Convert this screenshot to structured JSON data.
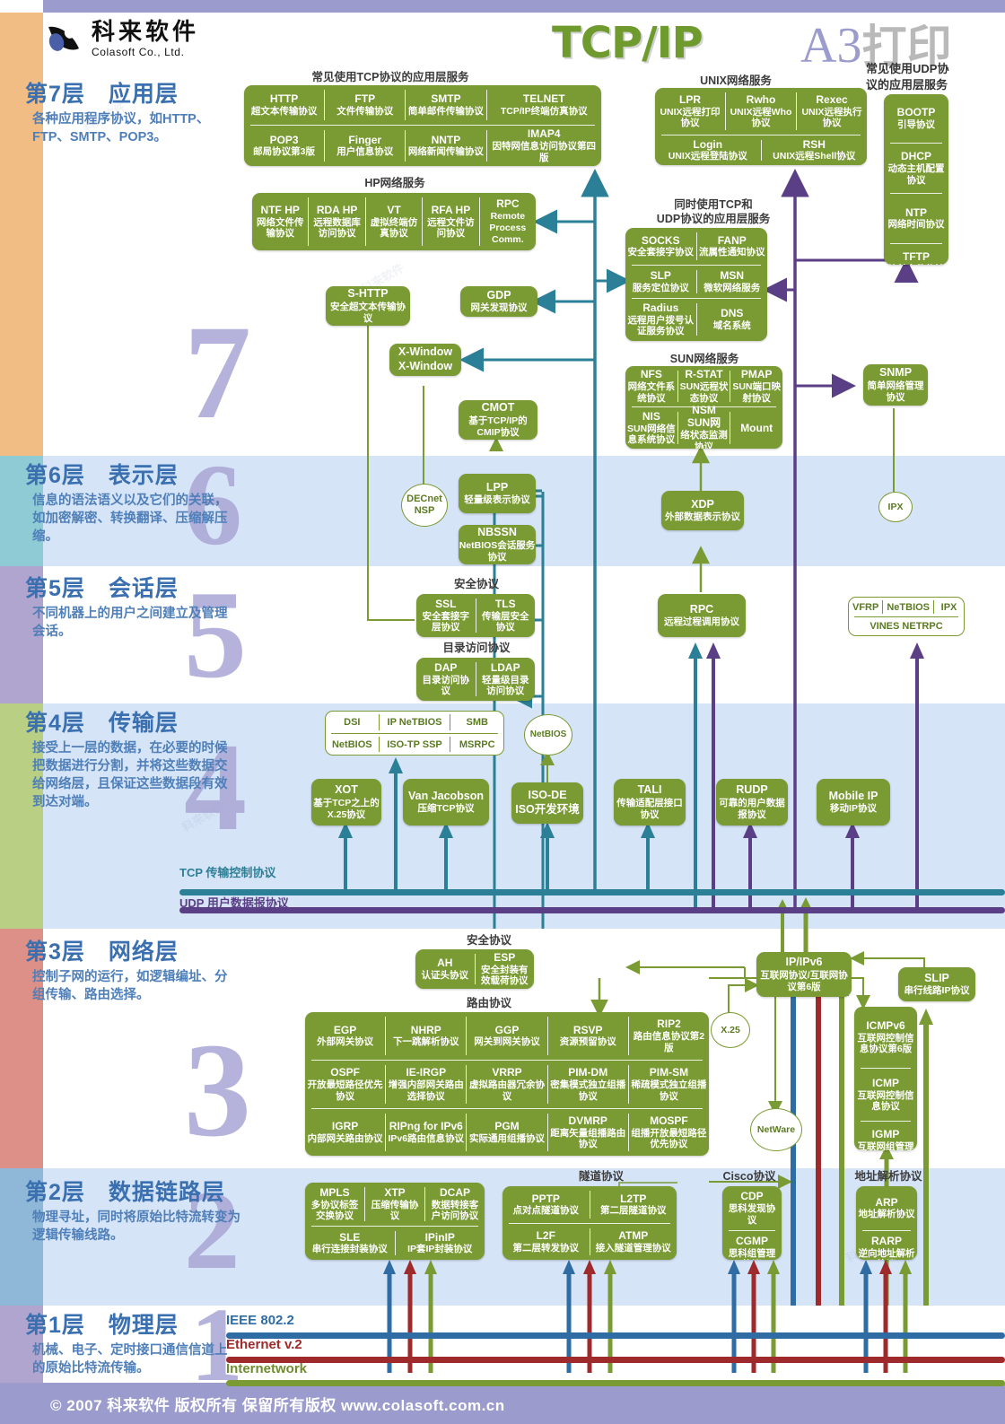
{
  "meta": {
    "title": "TCP/IP",
    "a3_a": "A3",
    "a3_b": "打印",
    "a3_caption": "常见使用UDP协\n议的应用层服务",
    "logo_cn": "科来软件",
    "logo_en": "Colasoft Co., Ltd.",
    "footer": "© 2007  科来软件  版权所有  保留所有版权  www.colasoft.com.cn",
    "accent_green": "#7a9a33",
    "accent_teal": "#2b7f96",
    "accent_purple": "#5b3f86",
    "accent_blue": "#3a6fb0",
    "band_blue": "#d6e4f7"
  },
  "layers": [
    {
      "id": "l7",
      "num": "7",
      "title": "第7层　应用层",
      "desc": "各种应用程序协议，如HTTP、FTP、SMTP、POP3。",
      "spine": "#f2bd85"
    },
    {
      "id": "l6",
      "num": "6",
      "title": "第6层　表示层",
      "desc": "信息的语法语义以及它们的关联，如加密解密、转换翻译、压缩解压缩。",
      "spine": "#8ecbd4"
    },
    {
      "id": "l5",
      "num": "5",
      "title": "第5层　会话层",
      "desc": "不同机器上的用户之间建立及管理会话。",
      "spine": "#b0a5ce"
    },
    {
      "id": "l4",
      "num": "4",
      "title": "第4层　传输层",
      "desc": "接受上一层的数据，在必要的时候把数据进行分割，并将这些数据交给网络层，且保证这些数据段有效到达对端。",
      "spine": "#b8cf84"
    },
    {
      "id": "l3",
      "num": "3",
      "title": "第3层　网络层",
      "desc": "控制子网的运行，如逻辑编址、分组传输、路由选择。",
      "spine": "#dd9088"
    },
    {
      "id": "l2",
      "num": "2",
      "title": "第2层　数据链路层",
      "desc": "物理寻址，同时将原始比特流转变为逻辑传输线路。",
      "spine": "#8fb7d8"
    },
    {
      "id": "l1",
      "num": "1",
      "title": "第1层　物理层",
      "desc": "机械、电子、定时接口通信信道上的原始比特流传输。",
      "spine": "#b0a5ce"
    }
  ],
  "captions": {
    "tcp_apps": "常见使用TCP协议的应用层服务",
    "unix": "UNIX网络服务",
    "hp": "HP网络服务",
    "tcp_udp_apps": "同时使用TCP和\nUDP协议的应用层服务",
    "sun": "SUN网络服务",
    "sec_l5": "安全协议",
    "dir_l5": "目录访问协议",
    "sec_l3": "安全协议",
    "routing": "路由协议",
    "tunnel": "隧道协议",
    "cisco": "Cisco协议",
    "arp": "地址解析协议"
  },
  "buses": {
    "tcp": {
      "label": "TCP 传输控制协议",
      "color": "#2b7f96"
    },
    "udp": {
      "label": "UDP 用户数据报协议",
      "color": "#5b3f86"
    },
    "ieee": {
      "label": "IEEE 802.2",
      "color": "#2f6ca3"
    },
    "ethernet": {
      "label": "Ethernet v.2",
      "color": "#9e2a2b"
    },
    "internetwork": {
      "label": "Internetwork",
      "color": "#7a9a33"
    }
  },
  "boxes": {
    "tcp_apps": [
      [
        {
          "nm": "HTTP",
          "cn": "超文本传输协议"
        },
        {
          "nm": "FTP",
          "cn": "文件传输协议"
        },
        {
          "nm": "SMTP",
          "cn": "简单邮件传输协议"
        },
        {
          "nm": "TELNET",
          "cn": "TCP/IP终端仿真协议"
        }
      ],
      [
        {
          "nm": "POP3",
          "cn": "邮局协议第3版"
        },
        {
          "nm": "Finger",
          "cn": "用户信息协议"
        },
        {
          "nm": "NNTP",
          "cn": "网络新闻传输协议"
        },
        {
          "nm": "IMAP4",
          "cn": "因特网信息访问协议第四版"
        }
      ]
    ],
    "unix": [
      [
        {
          "nm": "LPR",
          "cn": "UNIX远程打印协议"
        },
        {
          "nm": "Rwho",
          "cn": "UNIX远程Who协议"
        },
        {
          "nm": "Rexec",
          "cn": "UNIX远程执行协议"
        }
      ],
      [
        {
          "nm": "Login",
          "cn": "UNIX远程登陆协议"
        },
        {
          "nm": "RSH",
          "cn": "UNIX远程Shell协议"
        }
      ]
    ],
    "udp_apps": [
      {
        "nm": "BOOTP",
        "cn": "引导协议"
      },
      {
        "nm": "DHCP",
        "cn": "动态主机配置协议"
      },
      {
        "nm": "NTP",
        "cn": "网络时间协议"
      },
      {
        "nm": "TFTP",
        "cn": "简单文件传输协议"
      }
    ],
    "hp": [
      {
        "nm": "NTF HP",
        "cn": "网络文件传输协议"
      },
      {
        "nm": "RDA HP",
        "cn": "远程数据库访问协议"
      },
      {
        "nm": "VT",
        "cn": "虚拟终端仿真协议"
      },
      {
        "nm": "RFA HP",
        "cn": "远程文件访问协议"
      },
      {
        "nm": "RPC",
        "cn": "Remote Process Comm."
      }
    ],
    "tcp_udp_apps": [
      [
        {
          "nm": "SOCKS",
          "cn": "安全套接字协议"
        },
        {
          "nm": "FANP",
          "cn": "流属性通知协议"
        }
      ],
      [
        {
          "nm": "SLP",
          "cn": "服务定位协议"
        },
        {
          "nm": "MSN",
          "cn": "微软网络服务"
        }
      ],
      [
        {
          "nm": "Radius",
          "cn": "远程用户拨号认证服务协议"
        },
        {
          "nm": "DNS",
          "cn": "域名系统"
        }
      ]
    ],
    "sun": [
      [
        {
          "nm": "NFS",
          "cn": "网络文件系统协议"
        },
        {
          "nm": "R-STAT",
          "cn": "SUN远程状态协议"
        },
        {
          "nm": "PMAP",
          "cn": "SUN端口映射协议"
        }
      ],
      [
        {
          "nm": "NIS",
          "cn": "SUN网络信息系统协议"
        },
        {
          "nm": "NSM SUN网",
          "cn": "络状态监测协议"
        },
        {
          "nm": "Mount",
          "cn": ""
        }
      ]
    ],
    "shttp": {
      "nm": "S-HTTP",
      "cn": "安全超文本传输协议"
    },
    "gdp": {
      "nm": "GDP",
      "cn": "网关发现协议"
    },
    "xwindow": {
      "nm": "X-Window",
      "cn": "X-Window"
    },
    "cmot": {
      "nm": "CMOT",
      "cn": "基于TCP/IP的CMIP协议"
    },
    "snmp": {
      "nm": "SNMP",
      "cn": "简单网络管理协议"
    },
    "lpp": {
      "nm": "LPP",
      "cn": "轻量级表示协议"
    },
    "nbssn": {
      "nm": "NBSSN",
      "cn": "NetBIOS会话服务协议"
    },
    "xdp": {
      "nm": "XDP",
      "cn": "外部数据表示协议"
    },
    "decnet": "DECnet NSP",
    "ipx_l6": "IPX",
    "ssl_tls": [
      {
        "nm": "SSL",
        "cn": "安全套接字层协议"
      },
      {
        "nm": "TLS",
        "cn": "传输层安全协议"
      }
    ],
    "dap_ldap": [
      {
        "nm": "DAP",
        "cn": "目录访问协议"
      },
      {
        "nm": "LDAP",
        "cn": "轻量级目录访问协议"
      }
    ],
    "rpc_l5": {
      "nm": "RPC",
      "cn": "远程过程调用协议"
    },
    "vines": {
      "row": [
        "VFRP",
        "NeTBIOS",
        "IPX"
      ],
      "bottom": "VINES NETRPC"
    },
    "l4_white": [
      [
        "DSI",
        "IP NeTBIOS",
        "SMB"
      ],
      [
        "NetBIOS",
        "ISO-TP SSP",
        "MSRPC"
      ]
    ],
    "netbios_ell": "NetBIOS",
    "xot": {
      "nm": "XOT",
      "cn": "基于TCP之上的X.25协议"
    },
    "vanjacobson": {
      "nm": "Van Jacobson",
      "cn": "压缩TCP协议"
    },
    "isode": {
      "nm": "ISO-DE",
      "cn": "ISO开发环境"
    },
    "tali": {
      "nm": "TALI",
      "cn": "传输适配层接口协议"
    },
    "rudp": {
      "nm": "RUDP",
      "cn": "可靠的用户数据报协议"
    },
    "mobileip": {
      "nm": "Mobile IP",
      "cn": "移动IP协议"
    },
    "ah_esp": [
      {
        "nm": "AH",
        "cn": "认证头协议"
      },
      {
        "nm": "ESP",
        "cn": "安全封装有效载荷协议"
      }
    ],
    "routing": [
      [
        {
          "nm": "EGP",
          "cn": "外部网关协议"
        },
        {
          "nm": "NHRP",
          "cn": "下一跳解析协议"
        },
        {
          "nm": "GGP",
          "cn": "网关到网关协议"
        },
        {
          "nm": "RSVP",
          "cn": "资源预留协议"
        },
        {
          "nm": "RIP2",
          "cn": "路由信息协议第2版"
        }
      ],
      [
        {
          "nm": "OSPF",
          "cn": "开放最短路径优先协议"
        },
        {
          "nm": "IE-IRGP",
          "cn": "增强内部网关路由选择协议"
        },
        {
          "nm": "VRRP",
          "cn": "虚拟路由器冗余协议"
        },
        {
          "nm": "PIM-DM",
          "cn": "密集模式独立组播协议"
        },
        {
          "nm": "PIM-SM",
          "cn": "稀疏模式独立组播协议"
        }
      ],
      [
        {
          "nm": "IGRP",
          "cn": "内部网关路由协议"
        },
        {
          "nm": "RIPng for IPv6",
          "cn": "IPv6路由信息协议"
        },
        {
          "nm": "PGM",
          "cn": "实际通用组播协议"
        },
        {
          "nm": "DVMRP",
          "cn": "距离矢量组播路由协议"
        },
        {
          "nm": "MOSPF",
          "cn": "组播开放最短路径优先协议"
        }
      ]
    ],
    "ipv6": {
      "nm": "IP/IPv6",
      "cn": "互联网协议/互联网协议第6版"
    },
    "slip": {
      "nm": "SLIP",
      "cn": "串行线路IP协议"
    },
    "icmp_stack": [
      {
        "nm": "ICMPv6",
        "cn": "互联网控制信息协议第6版"
      },
      {
        "nm": "ICMP",
        "cn": "互联网控制信息协议"
      },
      {
        "nm": "IGMP",
        "cn": "互联网组管理协议"
      }
    ],
    "x25_ell": "X.25",
    "netware_ell": "NetWare",
    "l2_left": [
      [
        {
          "nm": "MPLS",
          "cn": "多协议标签交换协议"
        },
        {
          "nm": "XTP",
          "cn": "压缩传输协议"
        },
        {
          "nm": "DCAP",
          "cn": "数据转接客户访问协议"
        }
      ],
      [
        {
          "nm": "SLE",
          "cn": "串行连接封装协议"
        },
        {
          "nm": "IPinIP",
          "cn": "IP套IP封装协议"
        }
      ]
    ],
    "tunnel": [
      [
        {
          "nm": "PPTP",
          "cn": "点对点隧道协议"
        },
        {
          "nm": "L2TP",
          "cn": "第二层隧道协议"
        }
      ],
      [
        {
          "nm": "L2F",
          "cn": "第二层转发协议"
        },
        {
          "nm": "ATMP",
          "cn": "接入隧道管理协议"
        }
      ]
    ],
    "cisco": [
      {
        "nm": "CDP",
        "cn": "思科发现协议"
      },
      {
        "nm": "CGMP",
        "cn": "思科组管理协议"
      }
    ],
    "arp": [
      {
        "nm": "ARP",
        "cn": "地址解析协议"
      },
      {
        "nm": "RARP",
        "cn": "逆向地址解析协议"
      }
    ]
  }
}
